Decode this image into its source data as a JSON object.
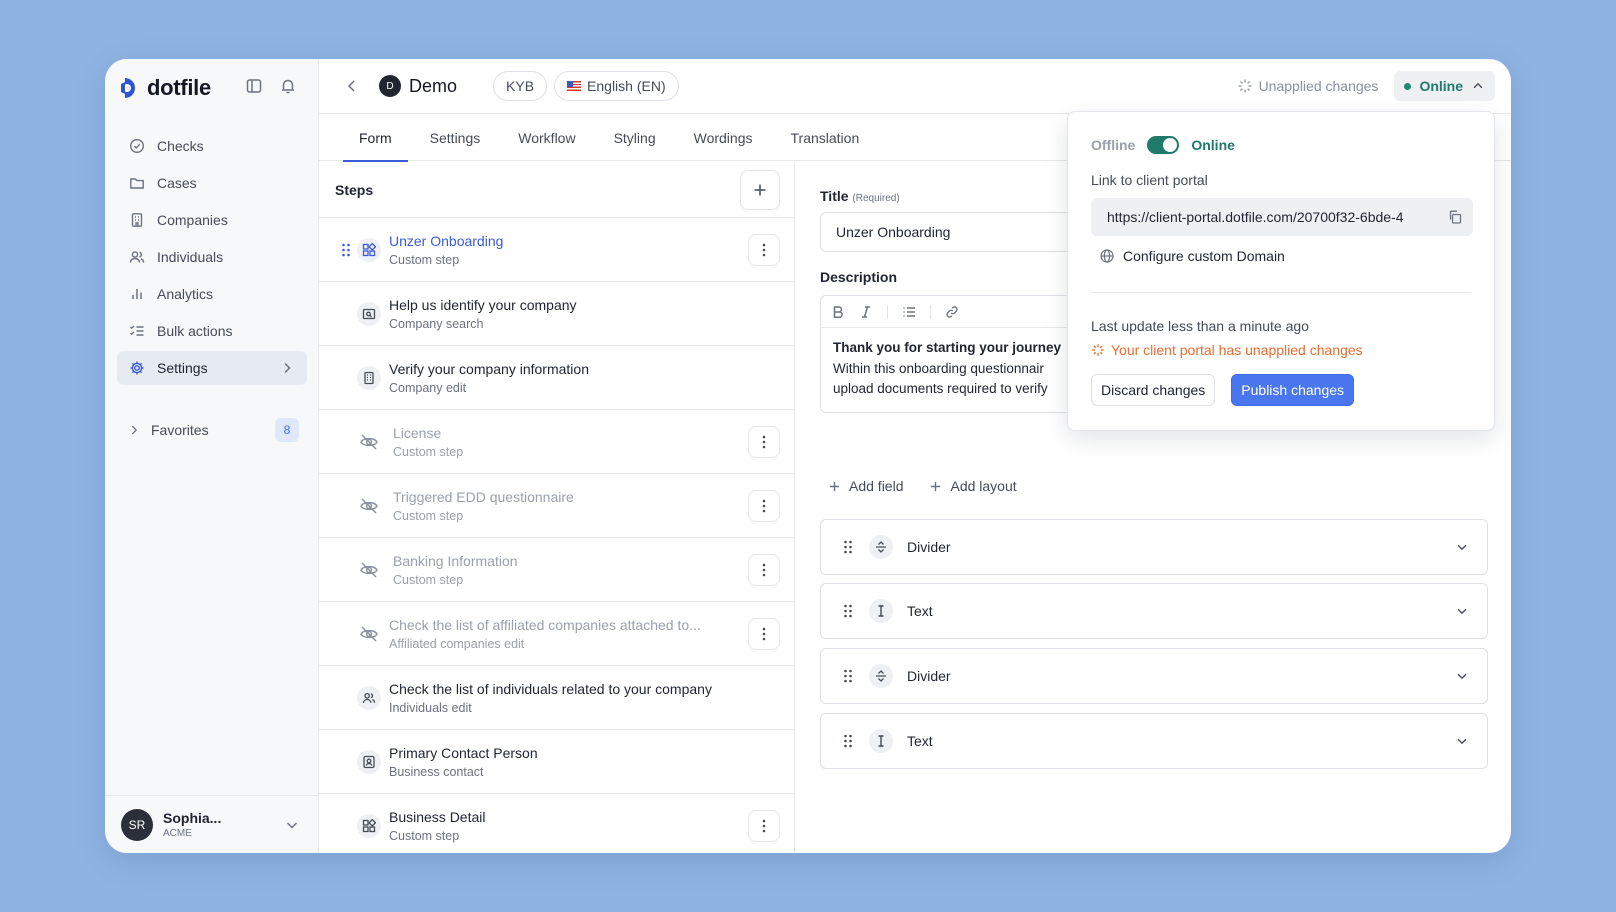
{
  "brand": {
    "name": "dotfile"
  },
  "sidebar": {
    "items": [
      {
        "label": "Checks",
        "icon": "check-circle-icon"
      },
      {
        "label": "Cases",
        "icon": "folder-icon"
      },
      {
        "label": "Companies",
        "icon": "building-icon"
      },
      {
        "label": "Individuals",
        "icon": "users-icon"
      },
      {
        "label": "Analytics",
        "icon": "bar-chart-icon"
      },
      {
        "label": "Bulk actions",
        "icon": "list-checks-icon"
      },
      {
        "label": "Settings",
        "icon": "gear-icon",
        "active": true
      }
    ],
    "favorites": {
      "label": "Favorites",
      "count": "8"
    },
    "user": {
      "initials": "SR",
      "name": "Sophia...",
      "org": "ACME"
    }
  },
  "header": {
    "workspace_initial": "D",
    "title": "Demo",
    "type_pill": "KYB",
    "language_pill": "English (EN)",
    "unapplied_label": "Unapplied changes",
    "status_label": "Online"
  },
  "tabs": [
    "Form",
    "Settings",
    "Workflow",
    "Styling",
    "Wordings",
    "Translation"
  ],
  "steps": {
    "heading": "Steps",
    "items": [
      {
        "title": "Unzer Onboarding",
        "subtitle": "Custom step",
        "state": "selected"
      },
      {
        "title": "Help us identify your company",
        "subtitle": "Company search",
        "state": "normal"
      },
      {
        "title": "Verify your company information",
        "subtitle": "Company edit",
        "state": "normal"
      },
      {
        "title": "License",
        "subtitle": "Custom step",
        "state": "hidden"
      },
      {
        "title": "Triggered EDD questionnaire",
        "subtitle": "Custom step",
        "state": "hidden"
      },
      {
        "title": "Banking Information",
        "subtitle": "Custom step",
        "state": "hidden"
      },
      {
        "title": "Check the list of affiliated companies attached to...",
        "subtitle": "Affiliated companies edit",
        "state": "hidden"
      },
      {
        "title": "Check the list of individuals related to your company",
        "subtitle": "Individuals edit",
        "state": "normal"
      },
      {
        "title": "Primary Contact Person",
        "subtitle": "Business contact",
        "state": "normal"
      },
      {
        "title": "Business Detail",
        "subtitle": "Custom step",
        "state": "normal"
      }
    ]
  },
  "editor": {
    "title_label": "Title",
    "required_label": "(Required)",
    "title_value": "Unzer Onboarding",
    "description_label": "Description",
    "description_lines": [
      "Thank you for starting your journey",
      "Within this onboarding questionnair",
      "upload documents required to verify"
    ],
    "add_field": "Add field",
    "add_layout": "Add layout",
    "blocks": [
      {
        "name": "Divider",
        "icon": "divider-icon"
      },
      {
        "name": "Text",
        "icon": "text-cursor-icon"
      },
      {
        "name": "Divider",
        "icon": "divider-icon"
      },
      {
        "name": "Text",
        "icon": "text-cursor-icon"
      }
    ]
  },
  "popover": {
    "offline_label": "Offline",
    "online_label": "Online",
    "link_label": "Link to client portal",
    "url": "https://client-portal.dotfile.com/20700f32-6bde-4",
    "configure_domain": "Configure custom Domain",
    "last_update": "Last update less than a minute ago",
    "warning": "Your client portal has unapplied changes",
    "discard": "Discard changes",
    "publish": "Publish changes"
  },
  "colors": {
    "accent": "#3b5bdb",
    "online": "#1f7a6a",
    "warning": "#f06b2f",
    "primary_button": "#4a76f0"
  }
}
